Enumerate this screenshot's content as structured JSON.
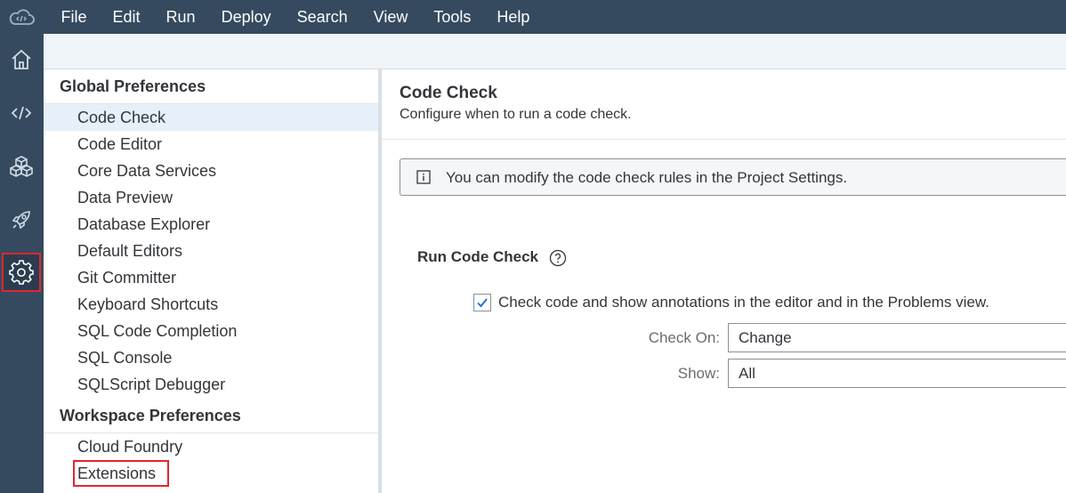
{
  "menubar": {
    "logo_icon": "cloud-code-icon",
    "menus": [
      "File",
      "Edit",
      "Run",
      "Deploy",
      "Search",
      "View",
      "Tools",
      "Help"
    ]
  },
  "iconbar": {
    "items": [
      {
        "icon": "home-icon"
      },
      {
        "icon": "code-icon"
      },
      {
        "icon": "cubes-icon"
      },
      {
        "icon": "rocket-icon"
      },
      {
        "icon": "gear-icon",
        "active": true
      }
    ]
  },
  "prefs": {
    "global_title": "Global Preferences",
    "global_items": [
      "Code Check",
      "Code Editor",
      "Core Data Services",
      "Data Preview",
      "Database Explorer",
      "Default Editors",
      "Git Committer",
      "Keyboard Shortcuts",
      "SQL Code Completion",
      "SQL Console",
      "SQLScript Debugger"
    ],
    "selected": "Code Check",
    "workspace_title": "Workspace Preferences",
    "workspace_items": [
      "Cloud Foundry",
      "Extensions"
    ]
  },
  "content": {
    "title": "Code Check",
    "subtitle": "Configure when to run a code check.",
    "info_text": "You can modify the code check rules in the Project Settings.",
    "section_title": "Run Code Check",
    "checkbox_label": "Check code and show annotations in the editor and in the Problems view.",
    "checkbox_checked": true,
    "check_on_label": "Check On:",
    "check_on_value": "Change",
    "show_label": "Show:",
    "show_value": "All"
  },
  "colors": {
    "shell": "#354a5f",
    "highlight_box": "#e3262e",
    "selected_row": "#e5f0fa"
  }
}
